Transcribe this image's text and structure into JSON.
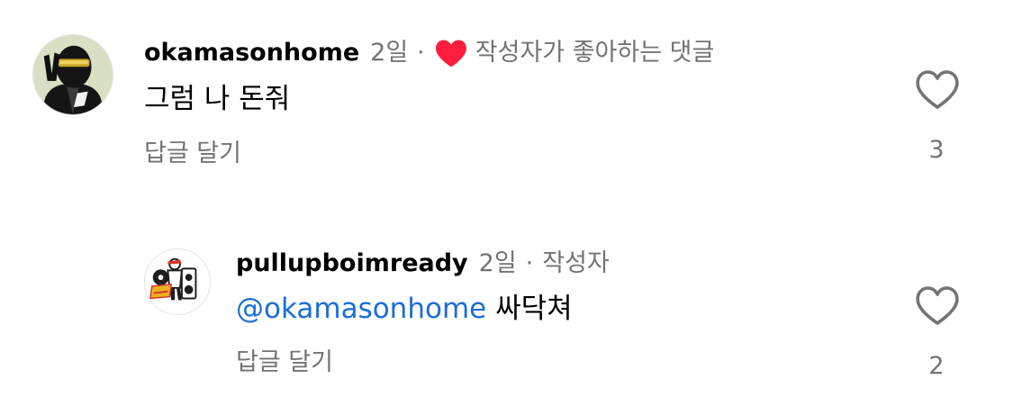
{
  "comments": [
    {
      "username": "okamasonhome",
      "time": "2일",
      "separator": "·",
      "liked_by_author_text": "작성자가 좋아하는 댓글",
      "text": "그럼 나 돈줘",
      "reply_label": "답글 달기",
      "like_count": "3",
      "heart_color": "#ff1e3c"
    },
    {
      "username": "pullupboimready",
      "time": "2일",
      "separator": "·",
      "author_tag": "작성자",
      "mention": "@okamasonhome",
      "text": "싸닥쳐",
      "reply_label": "답글 달기",
      "like_count": "2"
    }
  ]
}
